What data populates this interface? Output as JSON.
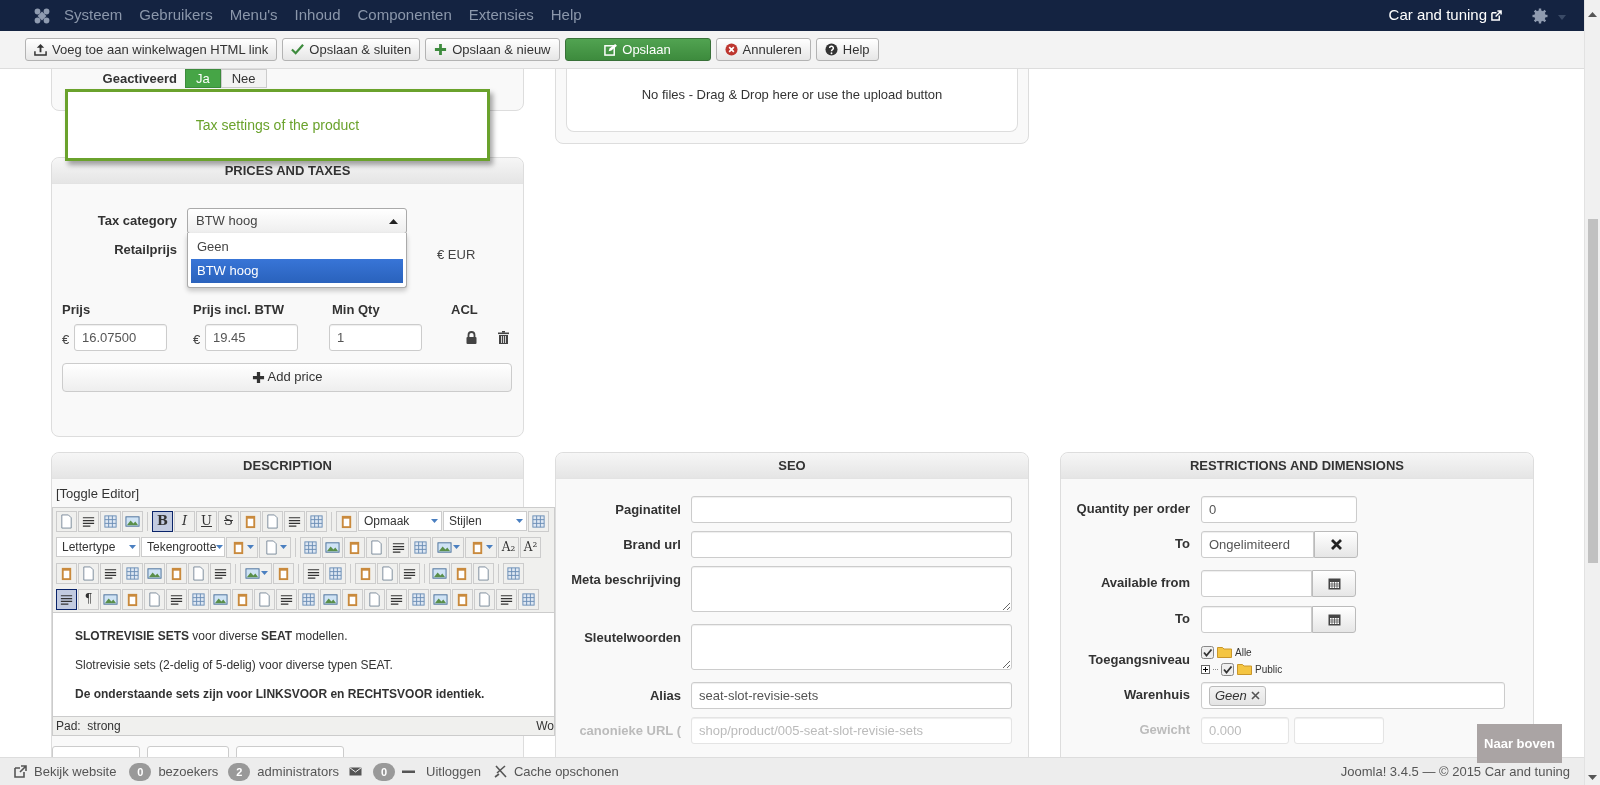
{
  "navbar": {
    "menu": [
      "Systeem",
      "Gebruikers",
      "Menu's",
      "Inhoud",
      "Componenten",
      "Extensies",
      "Help"
    ],
    "site_link": "Car and tuning"
  },
  "toolbar": [
    {
      "kind": "upload",
      "label": "Voeg toe aan winkelwagen HTML link"
    },
    {
      "kind": "save-close",
      "label": "Opslaan & sluiten"
    },
    {
      "kind": "save-new",
      "label": "Opslaan & nieuw"
    },
    {
      "kind": "save",
      "label": "Opslaan"
    },
    {
      "kind": "cancel",
      "label": "Annuleren"
    },
    {
      "kind": "help",
      "label": "Help"
    }
  ],
  "publish": {
    "label": "Geactiveerd",
    "options": [
      {
        "label": "Ja",
        "selected": true
      },
      {
        "label": "Nee",
        "selected": false
      }
    ]
  },
  "files": {
    "message": "No files - Drag & Drop here or use the upload button"
  },
  "tooltip": "Tax settings of the product",
  "prices": {
    "title": "PRICES AND TAXES",
    "tax_label": "Tax category",
    "tax_value": "BTW hoog",
    "tax_expanded": true,
    "tax_options": [
      {
        "label": "Geen",
        "selected": false
      },
      {
        "label": "BTW hoog",
        "selected": true
      }
    ],
    "retail_label": "Retailprijs",
    "retail_currency": "€ EUR",
    "columns": [
      "Prijs",
      "Prijs incl. BTW",
      "Min Qty",
      "ACL"
    ],
    "currency": [
      "€",
      "€"
    ],
    "price": "16.07500",
    "price_incl": "19.45",
    "min_qty": "1",
    "add_label": "Add price"
  },
  "description": {
    "title": "DESCRIPTION",
    "toggle": "[Toggle Editor]",
    "toolbar_rows": [
      [
        {
          "kind": "icon",
          "selected": false
        },
        {
          "kind": "icon",
          "selected": false
        },
        {
          "kind": "icon",
          "selected": false
        },
        {
          "kind": "icon",
          "selected": false
        },
        {
          "kind": "separator"
        },
        {
          "kind": "bold",
          "label": "B",
          "selected": true
        },
        {
          "kind": "italic",
          "label": "I",
          "selected": false
        },
        {
          "kind": "underline",
          "label": "U",
          "selected": false
        },
        {
          "kind": "strike",
          "label": "S",
          "selected": false
        },
        {
          "kind": "icon",
          "selected": false
        },
        {
          "kind": "icon",
          "selected": false
        },
        {
          "kind": "icon",
          "selected": false
        },
        {
          "kind": "icon",
          "selected": false
        },
        {
          "kind": "separator"
        },
        {
          "kind": "icon",
          "selected": false
        },
        {
          "kind": "dropdown",
          "label": "Opmaak"
        },
        {
          "kind": "dropdown",
          "label": "Stijlen"
        },
        {
          "kind": "icon",
          "selected": false
        }
      ],
      [
        {
          "kind": "dropdown",
          "label": "Lettertype"
        },
        {
          "kind": "dropdown",
          "label": "Tekengrootte"
        },
        {
          "kind": "split",
          "selected": false
        },
        {
          "kind": "split",
          "selected": false
        },
        {
          "kind": "separator"
        },
        {
          "kind": "icon",
          "selected": false
        },
        {
          "kind": "icon",
          "selected": false
        },
        {
          "kind": "icon",
          "selected": false
        },
        {
          "kind": "icon",
          "selected": false
        },
        {
          "kind": "icon",
          "selected": false
        },
        {
          "kind": "icon",
          "selected": false
        },
        {
          "kind": "split",
          "selected": false
        },
        {
          "kind": "split",
          "selected": false
        },
        {
          "kind": "glyph",
          "label": "A₂",
          "selected": false
        },
        {
          "kind": "glyph",
          "label": "A²",
          "selected": false
        }
      ],
      [
        {
          "kind": "icon",
          "selected": false
        },
        {
          "kind": "icon",
          "selected": false
        },
        {
          "kind": "icon",
          "selected": false
        },
        {
          "kind": "icon",
          "selected": false
        },
        {
          "kind": "icon",
          "selected": false
        },
        {
          "kind": "icon",
          "selected": false
        },
        {
          "kind": "icon",
          "selected": false
        },
        {
          "kind": "icon",
          "selected": false
        },
        {
          "kind": "separator"
        },
        {
          "kind": "split",
          "selected": false
        },
        {
          "kind": "icon",
          "selected": false
        },
        {
          "kind": "separator"
        },
        {
          "kind": "icon",
          "selected": false
        },
        {
          "kind": "icon",
          "selected": false
        },
        {
          "kind": "separator"
        },
        {
          "kind": "icon",
          "selected": false
        },
        {
          "kind": "icon",
          "selected": false
        },
        {
          "kind": "icon",
          "selected": false
        },
        {
          "kind": "separator"
        },
        {
          "kind": "icon",
          "selected": false
        },
        {
          "kind": "icon",
          "selected": false
        },
        {
          "kind": "icon",
          "selected": false
        },
        {
          "kind": "separator"
        },
        {
          "kind": "icon",
          "selected": false
        }
      ],
      [
        {
          "kind": "icon",
          "selected": true
        },
        {
          "kind": "glyph",
          "label": "¶",
          "selected": false
        },
        {
          "kind": "icon",
          "selected": false
        },
        {
          "kind": "icon",
          "selected": false
        },
        {
          "kind": "icon",
          "selected": false
        },
        {
          "kind": "icon",
          "selected": false
        },
        {
          "kind": "icon",
          "selected": false
        },
        {
          "kind": "icon",
          "selected": false
        },
        {
          "kind": "icon",
          "selected": false
        },
        {
          "kind": "icon",
          "selected": false
        },
        {
          "kind": "icon",
          "selected": false
        },
        {
          "kind": "icon",
          "selected": false
        },
        {
          "kind": "icon",
          "selected": false
        },
        {
          "kind": "icon",
          "selected": false
        },
        {
          "kind": "icon",
          "selected": false
        },
        {
          "kind": "icon",
          "selected": false
        },
        {
          "kind": "icon",
          "selected": false
        },
        {
          "kind": "icon",
          "selected": false
        },
        {
          "kind": "icon",
          "selected": false
        },
        {
          "kind": "icon",
          "selected": false
        },
        {
          "kind": "icon",
          "selected": false
        },
        {
          "kind": "icon",
          "selected": false
        }
      ]
    ],
    "paragraphs": [
      {
        "text": "**SLOTREVISIE SETS** voor diverse **SEAT** modellen.",
        "bold": false
      },
      {
        "text": "Slotrevisie sets (2-delig of 5-delig) voor diverse typen SEAT.",
        "bold": false
      },
      {
        "text": "De onderstaande sets zijn voor LINKSVOOR en RECHTSVOOR identiek.",
        "bold": true
      }
    ],
    "path_label": "Pad:",
    "path": "strong",
    "word_count": "Wo"
  },
  "seo": {
    "title": "SEO",
    "fields": [
      {
        "kind": "input",
        "label": "Paginatitel",
        "disabled": false
      },
      {
        "kind": "input",
        "label": "Brand url",
        "disabled": false
      },
      {
        "kind": "textarea",
        "label": "Meta beschrijving",
        "disabled": false
      },
      {
        "kind": "textarea",
        "label": "Sleutelwoorden",
        "disabled": false
      },
      {
        "kind": "input",
        "label": "Alias",
        "value": "seat-slot-revisie-sets",
        "disabled": false
      },
      {
        "kind": "input",
        "label": "canonieke URL (",
        "value": "shop/product/005-seat-slot-revisie-sets",
        "disabled": true
      }
    ]
  },
  "restrictions": {
    "title": "RESTRICTIONS AND DIMENSIONS",
    "fields": [
      {
        "kind": "input",
        "label": "Quantity per order",
        "value": "0",
        "disabled": false
      },
      {
        "kind": "clear",
        "label": "To",
        "value": "Ongelimiteerd",
        "disabled": false
      },
      {
        "kind": "date",
        "label": "Available from",
        "disabled": false
      },
      {
        "kind": "date",
        "label": "To",
        "disabled": false
      },
      {
        "kind": "tree",
        "label": "Toegangsniveau",
        "disabled": false,
        "tree": [
          {
            "label": "Alle",
            "checked": true,
            "children": [
              {
                "label": "Public",
                "checked": true,
                "expanded": false
              }
            ]
          }
        ]
      },
      {
        "kind": "tags",
        "label": "Warenhuis",
        "tags": [
          "Geen"
        ],
        "disabled": false
      },
      {
        "kind": "pair",
        "label": "Gewicht",
        "value": "0.000",
        "disabled": true
      }
    ]
  },
  "status": {
    "items": [
      {
        "kind": "site",
        "label": "Bekijk website"
      },
      {
        "kind": "count",
        "count": "0",
        "label": "bezoekers"
      },
      {
        "kind": "count",
        "count": "2",
        "label": "administrators"
      },
      {
        "kind": "mail",
        "count": "0"
      },
      {
        "kind": "logout",
        "label": "Uitloggen"
      },
      {
        "kind": "cache",
        "label": "Cache opschonen"
      }
    ],
    "footer": "Joomla! 3.4.5 — © 2015 Car and tuning"
  },
  "back_to_top": "Naar boven"
}
